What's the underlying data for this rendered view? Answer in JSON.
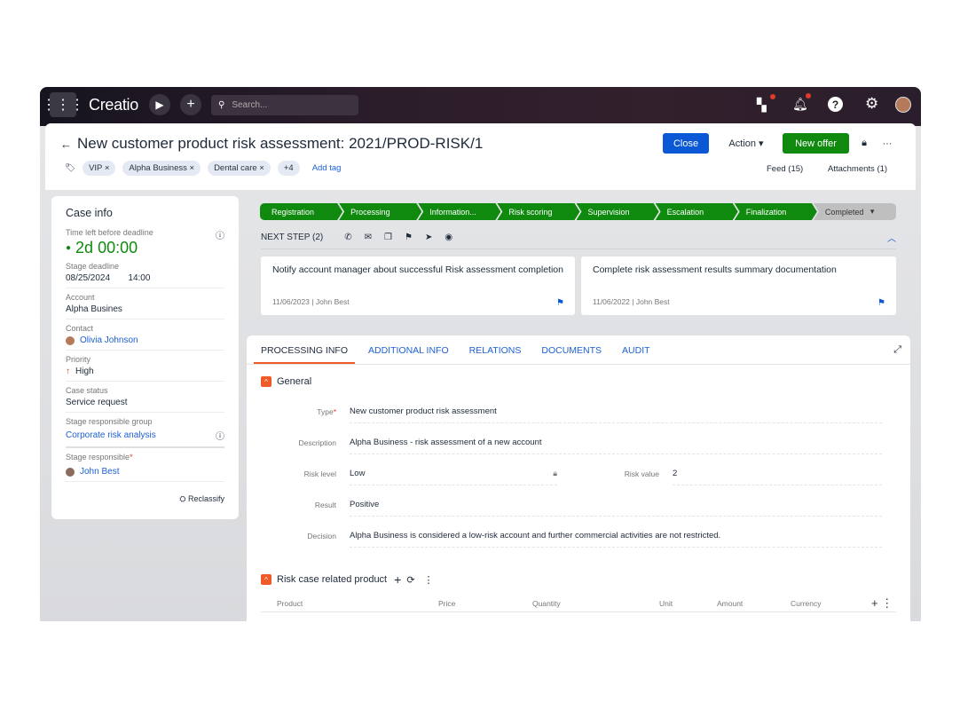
{
  "topbar": {
    "logo": "Creatio",
    "search_placeholder": "Search..."
  },
  "header": {
    "title": "New customer product risk assessment: 2021/PROD-RISK/1",
    "tags": [
      "VIP",
      "Alpha Business",
      "Dental care"
    ],
    "more_tags": "+4",
    "add_tag": "Add tag",
    "close": "Close",
    "action": "Action",
    "new_offer": "New offer",
    "feed": "Feed (15)",
    "attachments": "Attachments (1)"
  },
  "case_info": {
    "title": "Case info",
    "time_left_label": "Time left before deadline",
    "time_left": "2d 00:00",
    "stage_deadline_label": "Stage deadline",
    "deadline_date": "08/25/2024",
    "deadline_time": "14:00",
    "account_label": "Account",
    "account": "Alpha Busines",
    "contact_label": "Contact",
    "contact": "Olivia Johnson",
    "priority_label": "Priority",
    "priority": "High",
    "status_label": "Case status",
    "status": "Service request",
    "group_label": "Stage responsible group",
    "group": "Corporate risk analysis",
    "responsible_label": "Stage responsible",
    "responsible": "John Best",
    "reclassify": "Reclassify"
  },
  "stages": [
    "Registration",
    "Processing",
    "Information...",
    "Risk scoring",
    "Supervision",
    "Escalation",
    "Finalization",
    "Completed"
  ],
  "next_step": {
    "label": "NEXT STEP (2)",
    "cards": [
      {
        "text": "Notify account manager about successful Risk assessment completion",
        "meta": "11/06/2023 | John Best"
      },
      {
        "text": "Complete risk assessment results summary documentation",
        "meta": "11/06/2022 | John Best"
      }
    ]
  },
  "tabs": [
    "PROCESSING INFO",
    "ADDITIONAL INFO",
    "RELATIONS",
    "DOCUMENTS",
    "AUDIT"
  ],
  "general": {
    "title": "General",
    "type_label": "Type",
    "type": "New customer product risk assessment",
    "description_label": "Description",
    "description": "Alpha Business - risk assessment of a new account",
    "risk_level_label": "Risk level",
    "risk_level": "Low",
    "risk_value_label": "Risk value",
    "risk_value": "2",
    "result_label": "Result",
    "result": "Positive",
    "decision_label": "Decision",
    "decision": "Alpha Business is considered a low-risk account and further commercial activities are not restricted."
  },
  "products": {
    "title": "Risk case related product",
    "columns": [
      "Product",
      "Price",
      "Quantity",
      "Unit",
      "Amount",
      "Currency"
    ]
  },
  "colors": {
    "green": "#0f8a0f",
    "blue": "#0a58d6",
    "orange": "#f05a28"
  }
}
